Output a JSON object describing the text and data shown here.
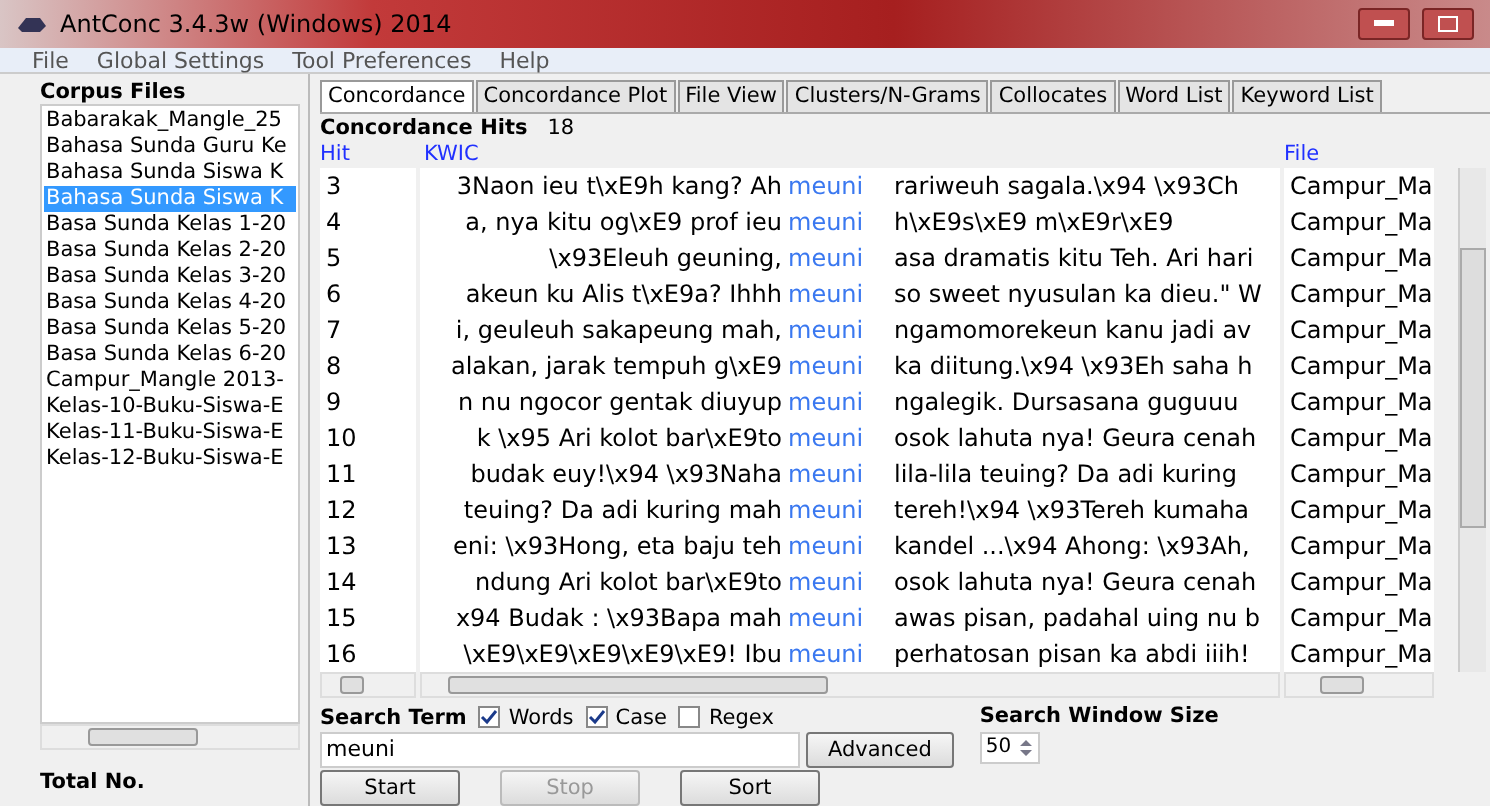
{
  "window": {
    "title": "AntConc 3.4.3w (Windows) 2014"
  },
  "menu": [
    "File",
    "Global Settings",
    "Tool Preferences",
    "Help"
  ],
  "corpus": {
    "title": "Corpus Files",
    "files": [
      {
        "name": "Babarakak_Mangle_25",
        "selected": false
      },
      {
        "name": "Bahasa Sunda Guru Ke",
        "selected": false
      },
      {
        "name": "Bahasa Sunda Siswa K",
        "selected": false
      },
      {
        "name": "Bahasa Sunda Siswa K",
        "selected": true
      },
      {
        "name": "Basa Sunda Kelas 1-20",
        "selected": false
      },
      {
        "name": "Basa Sunda Kelas 2-20",
        "selected": false
      },
      {
        "name": "Basa Sunda Kelas 3-20",
        "selected": false
      },
      {
        "name": "Basa Sunda Kelas 4-20",
        "selected": false
      },
      {
        "name": "Basa Sunda Kelas 5-20",
        "selected": false
      },
      {
        "name": "Basa Sunda Kelas 6-20",
        "selected": false
      },
      {
        "name": "Campur_Mangle 2013-",
        "selected": false
      },
      {
        "name": "Kelas-10-Buku-Siswa-E",
        "selected": false
      },
      {
        "name": "Kelas-11-Buku-Siswa-E",
        "selected": false
      },
      {
        "name": "Kelas-12-Buku-Siswa-E",
        "selected": false
      }
    ],
    "total_label": "Total No."
  },
  "tabs": [
    {
      "label": "Concordance",
      "selected": true
    },
    {
      "label": "Concordance Plot",
      "selected": false
    },
    {
      "label": "File View",
      "selected": false
    },
    {
      "label": "Clusters/N-Grams",
      "selected": false
    },
    {
      "label": "Collocates",
      "selected": false
    },
    {
      "label": "Word List",
      "selected": false
    },
    {
      "label": "Keyword List",
      "selected": false
    }
  ],
  "hits": {
    "label": "Concordance Hits",
    "value": "18"
  },
  "table": {
    "columns": [
      "Hit",
      "KWIC",
      "File"
    ],
    "rows": [
      {
        "hit": "3",
        "left": "3Naon ieu t\\xE9h kang? Ah",
        "keyword": "meuni",
        "right": "rariweuh sagala.\\x94  \\x93Ch",
        "file": "Campur_Ma"
      },
      {
        "hit": "4",
        "left": "a, nya kitu og\\xE9 prof ieu",
        "keyword": "meuni",
        "right": "h\\xE9s\\xE9 m\\xE9r\\xE9",
        "file": "Campur_Ma"
      },
      {
        "hit": "5",
        "left": "\\x93Eleuh geuning,",
        "keyword": "meuni",
        "right": "asa dramatis kitu Teh. Ari hari",
        "file": "Campur_Ma"
      },
      {
        "hit": "6",
        "left": "akeun ku Alis t\\xE9a? Ihhh",
        "keyword": "meuni",
        "right": "so sweet nyusulan ka dieu.\" W",
        "file": "Campur_Ma"
      },
      {
        "hit": "7",
        "left": "i, geuleuh sakapeung mah,",
        "keyword": "meuni",
        "right": "ngamomorekeun kanu jadi av",
        "file": "Campur_Ma"
      },
      {
        "hit": "8",
        "left": "alakan, jarak tempuh g\\xE9",
        "keyword": "meuni",
        "right": "ka diitung.\\x94  \\x93Eh saha h",
        "file": "Campur_Ma"
      },
      {
        "hit": "9",
        "left": "n nu ngocor gentak diuyup",
        "keyword": "meuni",
        "right": "ngalegik.  Dursasana guguuu",
        "file": "Campur_Ma"
      },
      {
        "hit": "10",
        "left": "k \\x95  Ari kolot bar\\xE9to",
        "keyword": "meuni",
        "right": "osok lahuta nya! Geura cenah",
        "file": "Campur_Ma"
      },
      {
        "hit": "11",
        "left": "budak euy!\\x94 \\x93Naha",
        "keyword": "meuni",
        "right": "lila-lila teuing? Da adi kuring",
        "file": "Campur_Ma"
      },
      {
        "hit": "12",
        "left": "teuing? Da adi kuring mah",
        "keyword": "meuni",
        "right": "tereh!\\x94 \\x93Tereh kumaha",
        "file": "Campur_Ma"
      },
      {
        "hit": "13",
        "left": "eni: \\x93Hong, eta baju teh",
        "keyword": "meuni",
        "right": "kandel ...\\x94 Ahong: \\x93Ah,",
        "file": "Campur_Ma"
      },
      {
        "hit": "14",
        "left": "ndung  Ari kolot bar\\xE9to",
        "keyword": "meuni",
        "right": "osok lahuta nya! Geura cenah",
        "file": "Campur_Ma"
      },
      {
        "hit": "15",
        "left": "x94 Budak : \\x93Bapa mah",
        "keyword": "meuni",
        "right": "awas pisan, padahal uing nu b",
        "file": "Campur_Ma"
      },
      {
        "hit": "16",
        "left": "\\xE9\\xE9\\xE9\\xE9\\xE9! Ibu",
        "keyword": "meuni",
        "right": "perhatosan pisan ka abdi iiih!",
        "file": "Campur_Ma"
      }
    ]
  },
  "search": {
    "label": "Search Term",
    "options": [
      {
        "label": "Words",
        "checked": true
      },
      {
        "label": "Case",
        "checked": true
      },
      {
        "label": "Regex",
        "checked": false
      }
    ],
    "value": "meuni",
    "advanced": "Advanced",
    "window_size_label": "Search Window Size",
    "window_size": "50"
  },
  "buttons": [
    {
      "label": "Start",
      "disabled": false
    },
    {
      "label": "Stop",
      "disabled": true
    },
    {
      "label": "Sort",
      "disabled": false
    }
  ]
}
